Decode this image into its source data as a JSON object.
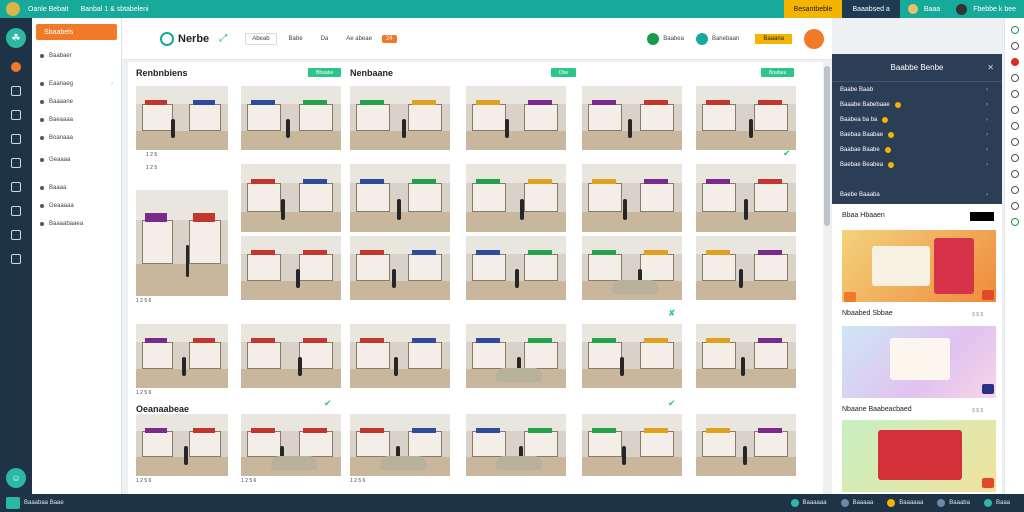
{
  "topbar": {
    "left_text_1": "Oanle Bebait",
    "left_text_2": "Banbal 1 & sbtabeleni",
    "accent_label": "Besantbeble",
    "dark_label": "Baaabsed a",
    "user_1": "Baaa",
    "user_2": "Fbebbe k bee"
  },
  "sidebar": {
    "search_label": "Sbaabels",
    "items": [
      {
        "label": "Baabaer"
      },
      {
        "label": "Eaanaeg"
      },
      {
        "label": "Baaaane"
      },
      {
        "label": "Baeaaaa"
      },
      {
        "label": "Boanaaa"
      },
      {
        "label": "Geaaaa"
      },
      {
        "label": "Baaaa"
      },
      {
        "label": "Geaaaaa"
      },
      {
        "label": "Baaaabaaea"
      }
    ]
  },
  "header": {
    "title": "Nerbe",
    "btn_1": "Abeab",
    "btn_2": "Babe",
    "btn_3": "Da",
    "btn_4": "Ae abeae",
    "count": "24",
    "right_1": "Baabea",
    "right_2": "Banebaan",
    "right_btn": "Baaana"
  },
  "content": {
    "section_1": "Renbnbiens",
    "section_2": "Nenbaane",
    "section_3": "Oeanaabeae",
    "badge_1": "Bbaabe",
    "badge_2": "Dbe",
    "badge_3": "Boabea",
    "caption_1": "1 2 5",
    "caption_2": "1 2 5 6",
    "caption_3": "1 2 5 6",
    "caption_4": "1 2 5 6",
    "caption_5": "1 2 5 6",
    "caption_6": "1 2 5 6"
  },
  "right_panel": {
    "title": "Baabbe Benbe",
    "rows": [
      {
        "label": "Baabe Baab"
      },
      {
        "label": "Baaabe Babebaae"
      },
      {
        "label": "Baabea ba ba"
      },
      {
        "label": "Baebaa Baabae"
      },
      {
        "label": "Baabae Baabe"
      },
      {
        "label": "Baebae Beabea"
      }
    ],
    "bottom": "Baebe Baaaba"
  },
  "right_cards": [
    {
      "title": "Bbaa Hbaaen"
    },
    {
      "title": "Nbaabed Sbbae",
      "price": "$ $ $"
    },
    {
      "title": "Nbaane Baabeacbaed",
      "price": "$ $ $"
    }
  ],
  "statusbar": {
    "left": "Baaabaa Baae",
    "items": [
      "Baaaaaa",
      "Baaaaa",
      "Baaaaaa",
      "Baaaba",
      "Baaa"
    ]
  },
  "colors": {
    "brand": "#17a99a",
    "accent": "#f07a27",
    "warn": "#f4b400",
    "dark": "#1f3346",
    "badge": "#2cc58a"
  }
}
